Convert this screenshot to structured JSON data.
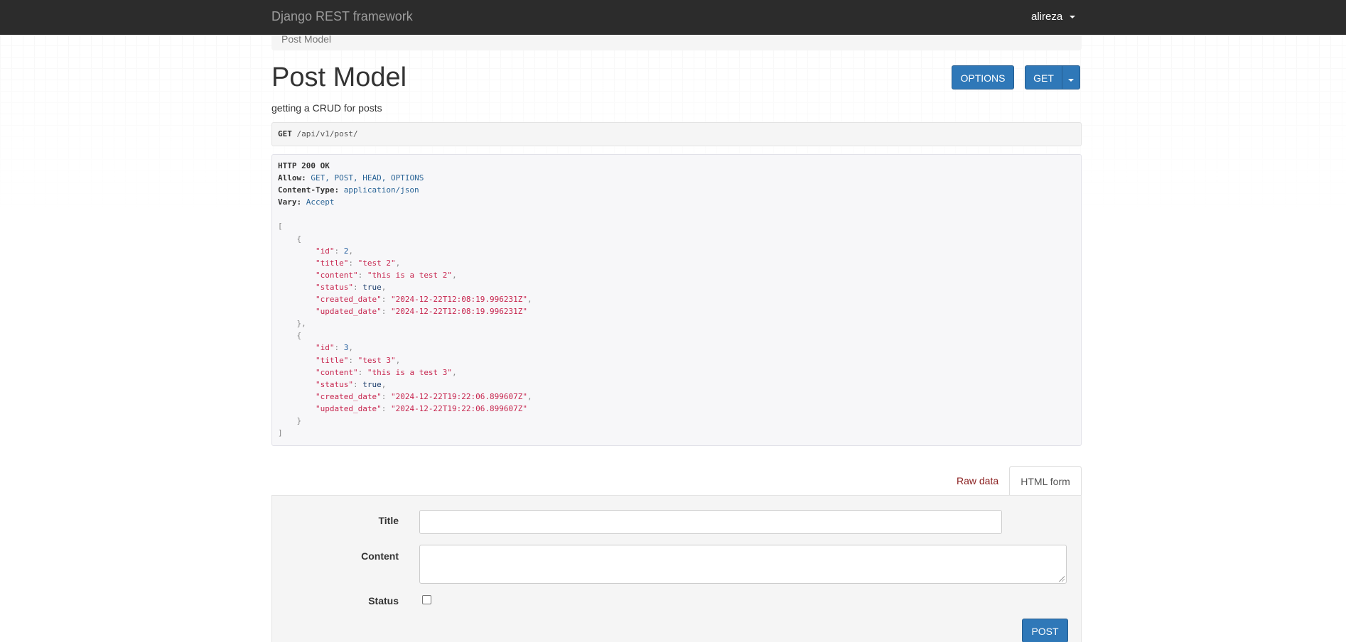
{
  "navbar": {
    "brand": "Django REST framework",
    "user": "alireza"
  },
  "breadcrumb": {
    "current": "Post Model"
  },
  "header": {
    "title": "Post Model",
    "description": "getting a CRUD for posts",
    "options_label": "OPTIONS",
    "get_label": "GET"
  },
  "request": {
    "method": "GET",
    "path": " /api/v1/post/"
  },
  "response": {
    "status_line": "HTTP 200 OK",
    "allow_key": "Allow:",
    "allow_val": "GET, POST, HEAD, OPTIONS",
    "ctype_key": "Content-Type:",
    "ctype_val": "application/json",
    "vary_key": "Vary:",
    "vary_val": "Accept",
    "items": [
      {
        "id": "2",
        "title": "\"test 2\"",
        "content": "\"this is a test 2\"",
        "status": "true",
        "created_date": "\"2024-12-22T12:08:19.996231Z\"",
        "updated_date": "\"2024-12-22T12:08:19.996231Z\""
      },
      {
        "id": "3",
        "title": "\"test 3\"",
        "content": "\"this is a test 3\"",
        "status": "true",
        "created_date": "\"2024-12-22T19:22:06.899607Z\"",
        "updated_date": "\"2024-12-22T19:22:06.899607Z\""
      }
    ]
  },
  "tabs": {
    "raw": "Raw data",
    "html": "HTML form"
  },
  "form": {
    "title_label": "Title",
    "title_value": "",
    "content_label": "Content",
    "content_value": "",
    "status_label": "Status",
    "post_label": "POST"
  },
  "colors": {
    "navbar_bg": "#2c2c2c",
    "primary_button": "#2f78b8",
    "json_string": "#c7254e",
    "json_number": "#1f5b9c",
    "raw_tab_text": "#8a1e1e"
  }
}
